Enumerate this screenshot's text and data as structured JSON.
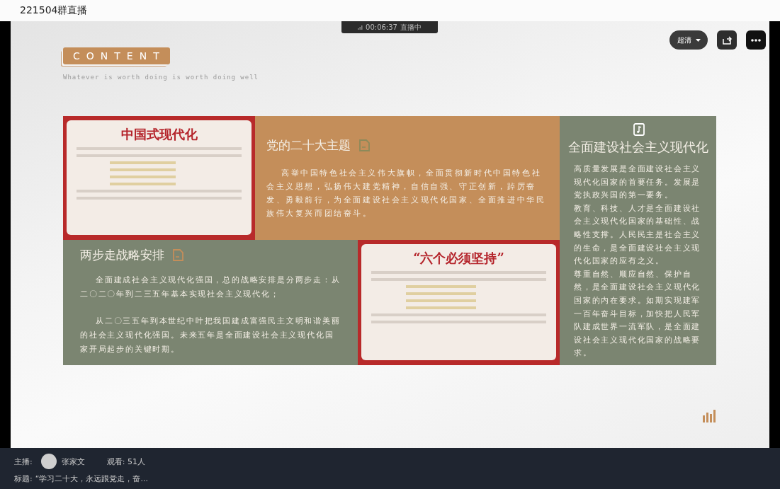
{
  "window": {
    "title": "221504群直播"
  },
  "live_badge": {
    "time": "00:06:37",
    "status": "直播中"
  },
  "player_controls": {
    "quality": "超清"
  },
  "slide": {
    "badge": "CONTENT",
    "subtitle": "Whatever is worth doing is worth doing well",
    "cards": [
      {
        "kind": "image",
        "title": "中国式现代化"
      },
      {
        "kind": "text",
        "color": "#c48e5a",
        "title": "党的二十大主题",
        "paragraphs": [
          "高举中国特色社会主义伟大旗帜，全面贯彻新时代中国特色社会主义思想，弘扬伟大建党精神，自信自强、守正创新，踔厉奋发、勇毅前行，为全面建设社会主义现代化国家、全面推进中华民族伟大复兴而团结奋斗。"
        ]
      },
      {
        "kind": "text",
        "color": "#7b8571",
        "title": "两步走战略安排",
        "paragraphs": [
          "全面建成社会主义现代化强国，总的战略安排是分两步走：从二〇二〇年到二三五年基本实现社会主义现代化；",
          "从二〇三五年到本世纪中叶把我国建成富强民主文明和谐美丽的社会主义现代化强国。未来五年是全面建设社会主义现代化国家开局起步的关键时期。"
        ]
      },
      {
        "kind": "image",
        "title": "“六个必须坚持”"
      },
      {
        "kind": "tall",
        "color": "#7b8571",
        "title": "全面建设社会主义现代化",
        "paragraphs": [
          "高质量发展是全面建设社会主义现代化国家的首要任务。发展是党执政兴国的第一要务。",
          "教育、科技、人才是全面建设社会主义现代化国家的基础性、战略性支撑。人民民主是社会主义的生命，是全面建设社会主义现代化国家的应有之义。",
          "尊重自然、顺应自然、保护自然，是全面建设社会主义现代化国家的内在要求。如期实现建军一百年奋斗目标，加快把人民军队建成世界一流军队，是全面建设社会主义现代化国家的战略要求。"
        ]
      }
    ]
  },
  "footer": {
    "host_label": "主播:",
    "host_name": "张家文",
    "viewers": "观看: 51人",
    "title_label": "标题:",
    "title": "“学习二十大，永远跟党走，奋..."
  }
}
